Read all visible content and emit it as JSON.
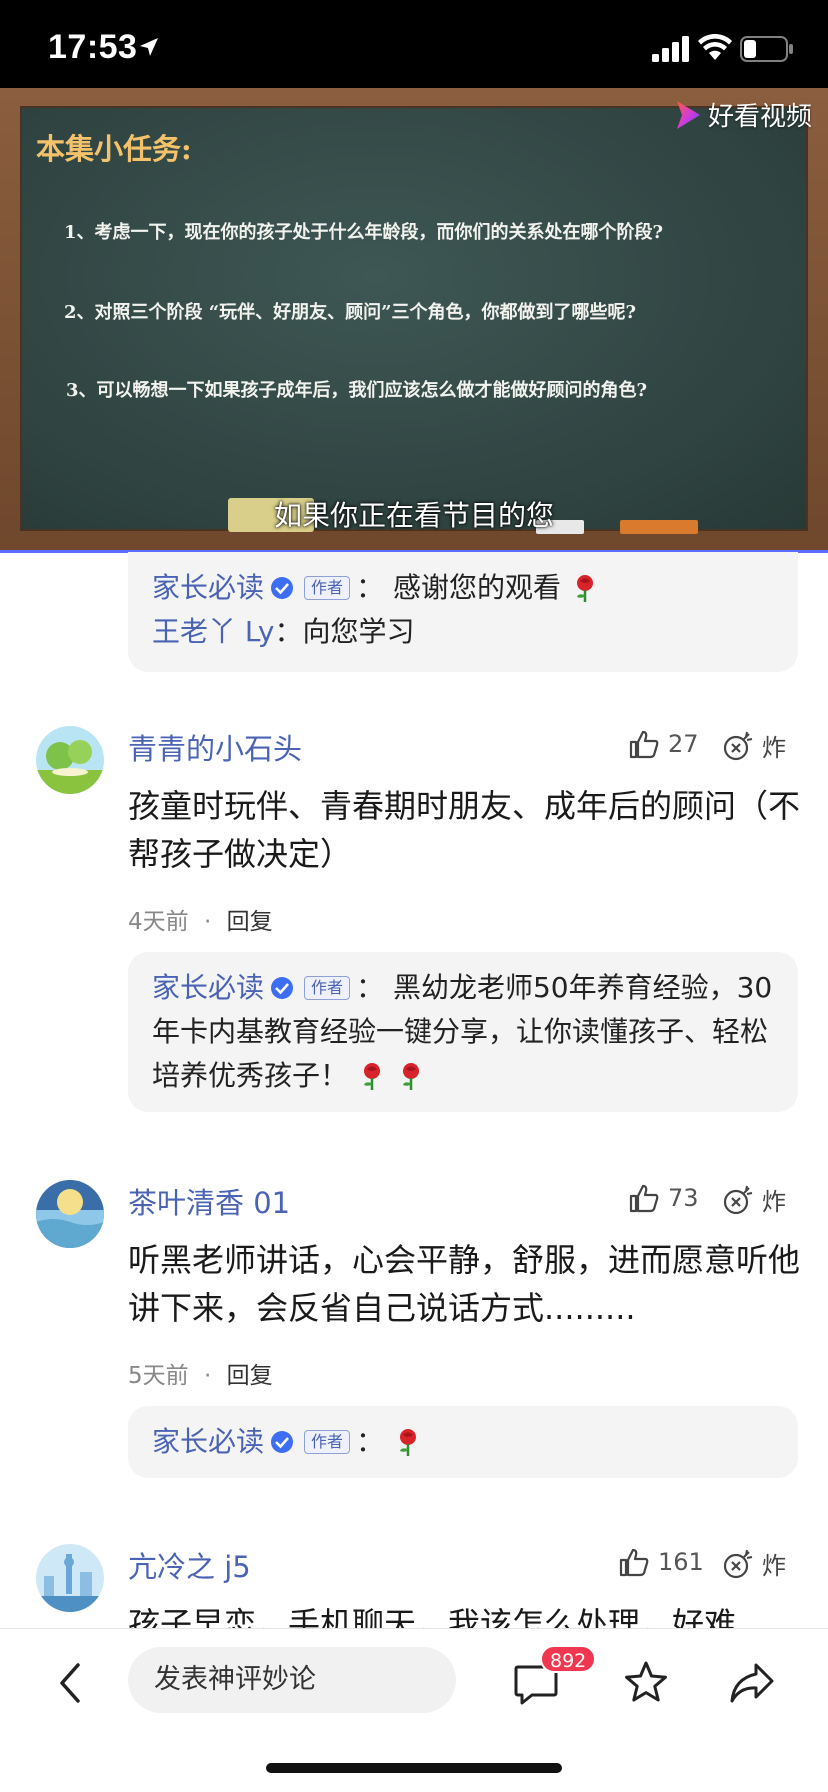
{
  "status_bar": {
    "time": "17:53"
  },
  "video": {
    "title": "本集小任务:",
    "lines": [
      "1、考虑一下，现在你的孩子处于什么年龄段，而你们的关系处在哪个阶段?",
      "2、对照三个阶段 “玩伴、好朋友、顾问”三个角色，你都做到了哪些呢?",
      "3、可以畅想一下如果孩子成年后，我们应该怎么做才能做好顾问的角色?"
    ],
    "brand": "好看视频",
    "subtitle": "如果你正在看节目的您"
  },
  "top_replies": [
    {
      "name": "家长必读",
      "tag": "作者",
      "sep": "：",
      "text": "感谢您的观看"
    },
    {
      "name": "王老丫 Ly",
      "sep": "：",
      "text": "向您学习"
    }
  ],
  "comments": [
    {
      "name": "青青的小石头",
      "likes": "27",
      "zha": "炸",
      "text": "孩童时玩伴、青春期时朋友、成年后的顾问（不帮孩子做决定）",
      "time": "4天前",
      "dot": "·",
      "reply_label": "回复",
      "reply": {
        "name": "家长必读",
        "tag": "作者",
        "sep": "：",
        "text": "黑幼龙老师50年养育经验，30年卡内基教育经验一键分享，让你读懂孩子、轻松培养优秀孩子！"
      }
    },
    {
      "name": "茶叶清香 01",
      "likes": "73",
      "zha": "炸",
      "text": "听黑老师讲话，心会平静，舒服，进而愿意听他讲下来，会反省自己说话方式.........",
      "time": "5天前",
      "dot": "·",
      "reply_label": "回复",
      "reply": {
        "name": "家长必读",
        "tag": "作者",
        "sep": "：",
        "text": ""
      }
    },
    {
      "name": "亢冷之 j5",
      "likes": "161",
      "zha": "炸",
      "text": "孩子早恋，手机聊天，我该怎么处理，好难"
    }
  ],
  "bottom_bar": {
    "input_placeholder": "发表神评妙论",
    "comment_count": "892"
  },
  "colors": {
    "link_blue": "#4a63b5",
    "badge_red": "#f0374f",
    "progress_blue": "#5b6dff"
  }
}
